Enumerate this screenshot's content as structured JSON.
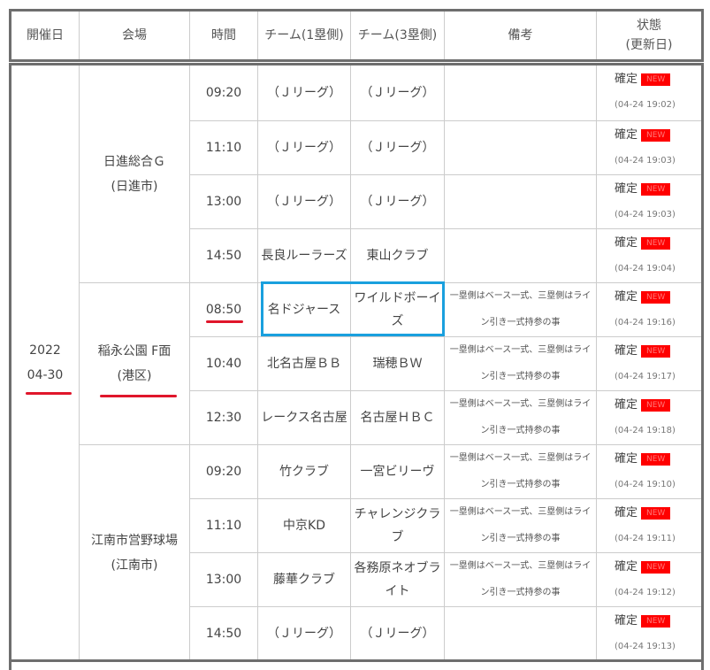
{
  "header": {
    "date": "開催日",
    "venue": "会場",
    "time": "時間",
    "team1": "チーム(1塁側)",
    "team3": "チーム(3塁側)",
    "note": "備考",
    "status_line1": "状態",
    "status_line2": "(更新日)"
  },
  "date": {
    "year": "2022",
    "day": "04-30"
  },
  "venues": [
    {
      "name": "日進総合Ｇ",
      "city": "(日進市)"
    },
    {
      "name": "稲永公園 F面",
      "city": "(港区)"
    },
    {
      "name": "江南市営野球場",
      "city": "(江南市)"
    }
  ],
  "note_text": {
    "line1": "一塁側はベース一式、三塁側はライ",
    "line2": "ン引き一式持参の事"
  },
  "status": {
    "label": "確定",
    "badge": "NEW"
  },
  "games": [
    {
      "time": "09:20",
      "team1": "（Ｊリーグ）",
      "team3": "（Ｊリーグ）",
      "note": false,
      "updated": "(04-24 19:02)"
    },
    {
      "time": "11:10",
      "team1": "（Ｊリーグ）",
      "team3": "（Ｊリーグ）",
      "note": false,
      "updated": "(04-24 19:03)"
    },
    {
      "time": "13:00",
      "team1": "（Ｊリーグ）",
      "team3": "（Ｊリーグ）",
      "note": false,
      "updated": "(04-24 19:03)"
    },
    {
      "time": "14:50",
      "team1": "長良ルーラーズ",
      "team3": "東山クラブ",
      "note": false,
      "updated": "(04-24 19:04)"
    },
    {
      "time": "08:50",
      "team1": "名ドジャース",
      "team3a": "ワイルドボーイ",
      "team3b": "ズ",
      "note": true,
      "updated": "(04-24 19:16)"
    },
    {
      "time": "10:40",
      "team1": "北名古屋ＢＢ",
      "team3": "瑞穂ＢＷ",
      "note": true,
      "updated": "(04-24 19:17)"
    },
    {
      "time": "12:30",
      "team1": "レークス名古屋",
      "team3": "名古屋ＨＢＣ",
      "note": true,
      "updated": "(04-24 19:18)"
    },
    {
      "time": "09:20",
      "team1": "竹クラブ",
      "team3": "一宮ビリーヴ",
      "note": true,
      "updated": "(04-24 19:10)"
    },
    {
      "time": "11:10",
      "team1": "中京KD",
      "team3a": "チャレンジクラ",
      "team3b": "ブ",
      "note": true,
      "updated": "(04-24 19:11)"
    },
    {
      "time": "13:00",
      "team1": "藤華クラブ",
      "team3a": "各務原ネオブラ",
      "team3b": "イト",
      "note": true,
      "updated": "(04-24 19:12)"
    },
    {
      "time": "14:50",
      "team1": "（Ｊリーグ）",
      "team3": "（Ｊリーグ）",
      "note": false,
      "updated": "(04-24 19:13)"
    }
  ],
  "colors": {
    "border_dark": "#6e6e6e",
    "annotation_red": "#e0162b",
    "annotation_blue": "#1aa0de",
    "badge_red": "#ff0000"
  }
}
